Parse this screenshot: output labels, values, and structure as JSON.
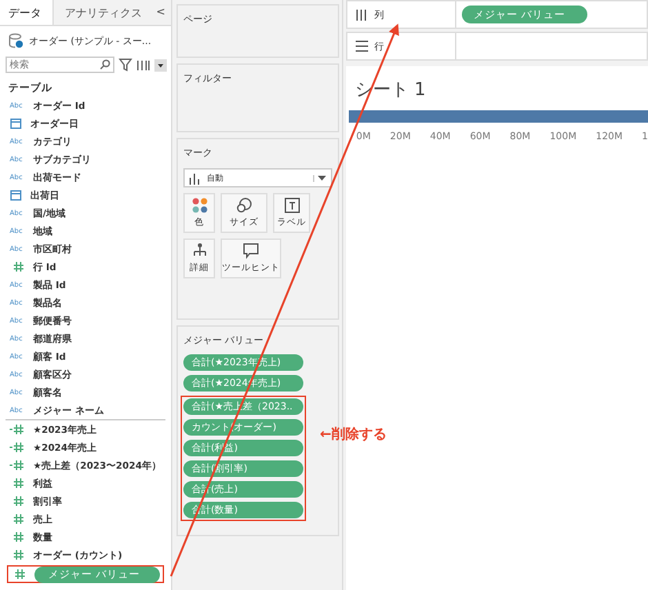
{
  "sidebar": {
    "tabs": [
      {
        "label": "データ",
        "selected": true
      },
      {
        "label": "アナリティクス",
        "selected": false
      }
    ],
    "collapse": "<",
    "data_source": "オーダー (サンプル - スー...",
    "search": {
      "placeholder": "検索"
    },
    "section_title": "テーブル",
    "fields": [
      {
        "name": "オーダー Id",
        "kind": "text",
        "type_label": "Abc",
        "highlighted": false
      },
      {
        "name": "オーダー日",
        "kind": "date",
        "highlighted": false
      },
      {
        "name": "カテゴリ",
        "kind": "text",
        "type_label": "Abc",
        "highlighted": false
      },
      {
        "name": "サブカテゴリ",
        "kind": "text",
        "type_label": "Abc",
        "highlighted": false
      },
      {
        "name": "出荷モード",
        "kind": "text",
        "type_label": "Abc",
        "highlighted": false
      },
      {
        "name": "出荷日",
        "kind": "date",
        "highlighted": false
      },
      {
        "name": "国/地域",
        "kind": "text",
        "type_label": "Abc",
        "highlighted": false
      },
      {
        "name": "地域",
        "kind": "text",
        "type_label": "Abc",
        "highlighted": false
      },
      {
        "name": "市区町村",
        "kind": "text",
        "type_label": "Abc",
        "highlighted": false
      },
      {
        "name": "行 Id",
        "kind": "number",
        "highlighted": false
      },
      {
        "name": "製品 Id",
        "kind": "text",
        "type_label": "Abc",
        "highlighted": false
      },
      {
        "name": "製品名",
        "kind": "text",
        "type_label": "Abc",
        "highlighted": false
      },
      {
        "name": "郵便番号",
        "kind": "text",
        "type_label": "Abc",
        "highlighted": false
      },
      {
        "name": "都道府県",
        "kind": "text",
        "type_label": "Abc",
        "highlighted": false
      },
      {
        "name": "顧客 Id",
        "kind": "text",
        "type_label": "Abc",
        "highlighted": false
      },
      {
        "name": "顧客区分",
        "kind": "text",
        "type_label": "Abc",
        "highlighted": false
      },
      {
        "name": "顧客名",
        "kind": "text",
        "type_label": "Abc",
        "highlighted": false
      },
      {
        "name": "メジャー ネーム",
        "kind": "text",
        "type_label": "Abc",
        "highlighted": false
      },
      {
        "name": "★2023年売上",
        "kind": "calc",
        "highlighted": false
      },
      {
        "name": "★2024年売上",
        "kind": "calc",
        "highlighted": false
      },
      {
        "name": "★売上差（2023〜2024年）",
        "kind": "calc",
        "highlighted": false
      },
      {
        "name": "利益",
        "kind": "number",
        "highlighted": false
      },
      {
        "name": "割引率",
        "kind": "number",
        "highlighted": false
      },
      {
        "name": "売上",
        "kind": "number",
        "highlighted": false
      },
      {
        "name": "数量",
        "kind": "number",
        "highlighted": false
      },
      {
        "name": "オーダー (カウント)",
        "kind": "number",
        "highlighted": false
      },
      {
        "name": "メジャー バリュー",
        "kind": "pill",
        "highlighted": true
      }
    ]
  },
  "cards": {
    "pages": "ページ",
    "filters": "フィルター",
    "marks": {
      "title": "マーク",
      "mark_type": "自動",
      "buttons": [
        {
          "label": "色",
          "kind": "color"
        },
        {
          "label": "サイズ",
          "kind": "size"
        },
        {
          "label": "ラベル",
          "kind": "label"
        },
        {
          "label": "詳細",
          "kind": "detail"
        },
        {
          "label": "ツールヒント",
          "kind": "tooltip"
        }
      ]
    },
    "measure_values": {
      "title": "メジャー バリュー",
      "pills": [
        {
          "label": "合計(★2023年売上)",
          "highlighted": false
        },
        {
          "label": "合計(★2024年売上)",
          "highlighted": false
        },
        {
          "label": "合計(★売上差（2023..",
          "highlighted": true
        },
        {
          "label": "カウント(オーダー)",
          "highlighted": true
        },
        {
          "label": "合計(利益)",
          "highlighted": true
        },
        {
          "label": "合計(割引率)",
          "highlighted": true
        },
        {
          "label": "合計(売上)",
          "highlighted": true
        },
        {
          "label": "合計(数量)",
          "highlighted": true
        }
      ]
    }
  },
  "shelves": [
    {
      "label": "列",
      "kind": "columns",
      "pill": "メジャー バリュー"
    },
    {
      "label": "行",
      "kind": "rows"
    }
  ],
  "sheet": {
    "title": "シート 1",
    "axis_ticks": [
      "0M",
      "20M",
      "40M",
      "60M",
      "80M",
      "100M",
      "120M",
      "1"
    ]
  },
  "annotation": {
    "note": "←削除する"
  }
}
